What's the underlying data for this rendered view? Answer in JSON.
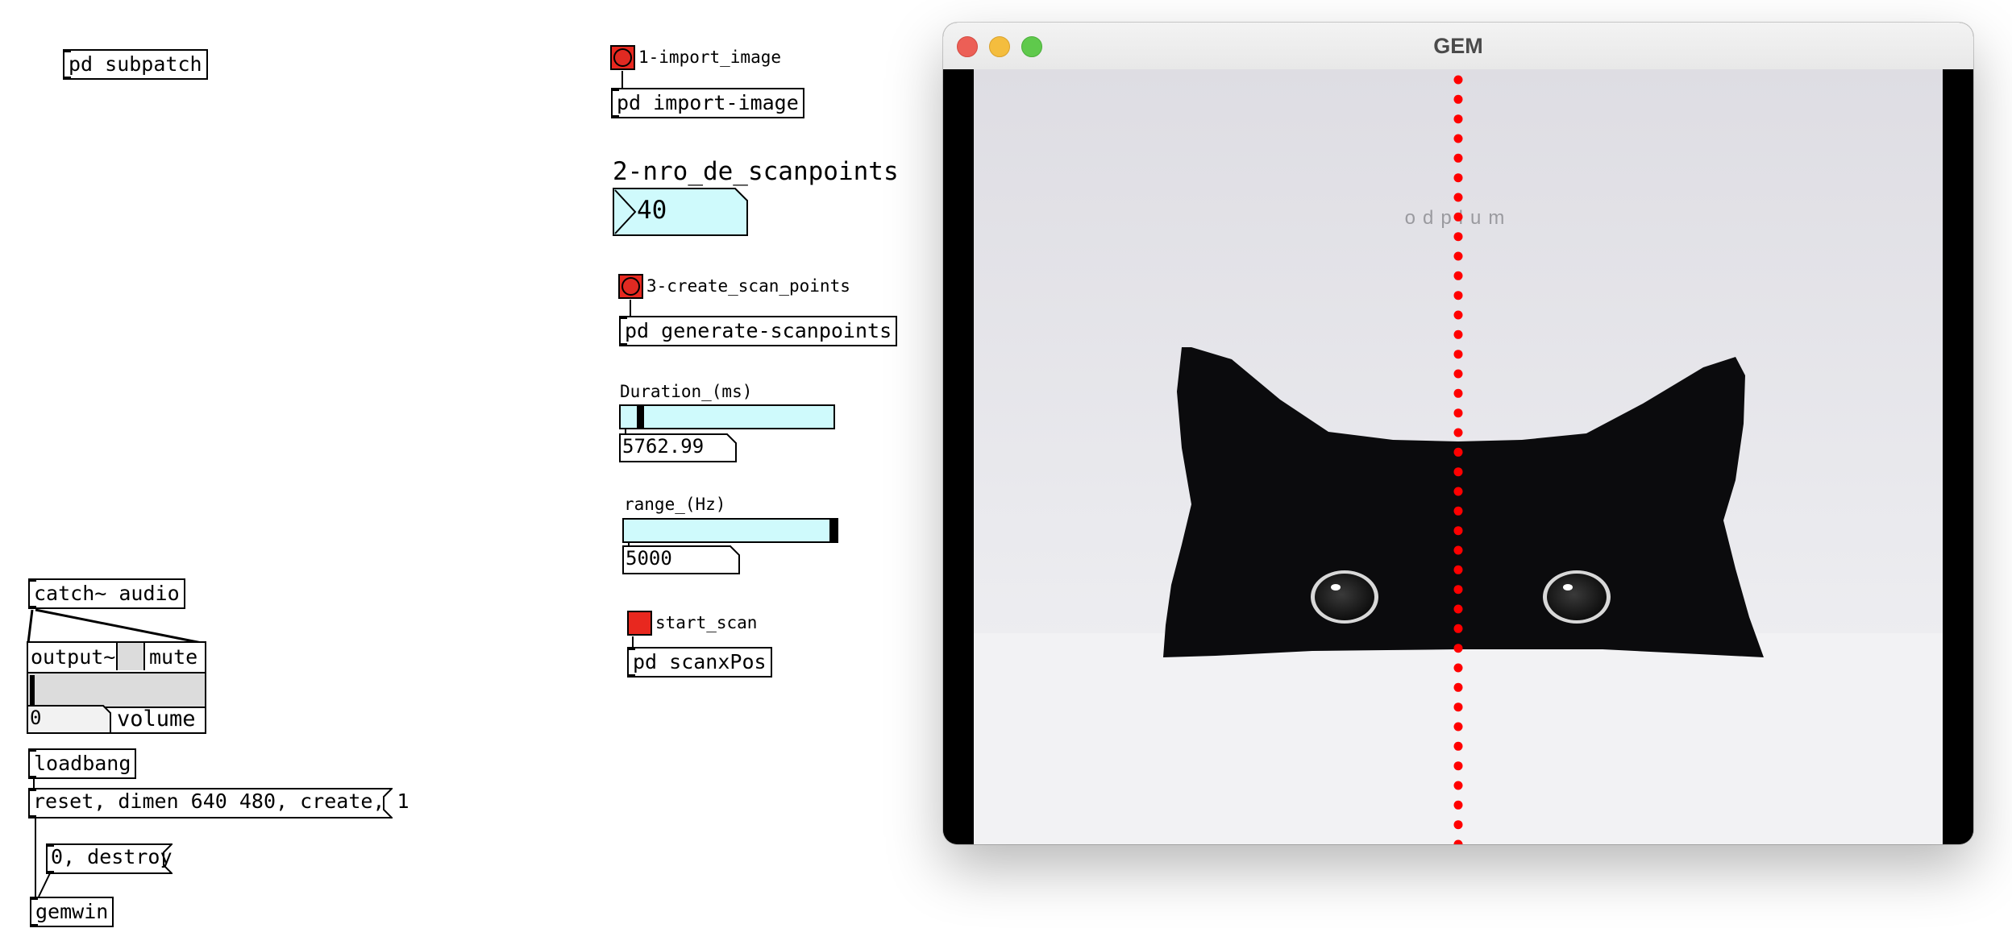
{
  "patch": {
    "subpatch_label": "pd subpatch",
    "catch_audio": "catch~ audio",
    "output_label": "output~",
    "mute_label": "mute",
    "volume_value": "0",
    "volume_label": "volume",
    "loadbang": "loadbang",
    "reset_msg": "reset, dimen 640 480, create, 1",
    "destroy_msg": "0, destroy",
    "gemwin": "gemwin",
    "import_bang_label": "1-import_image",
    "import_obj": "pd import-image",
    "scanpoints_label": "2-nro_de_scanpoints",
    "scanpoints_value": "40",
    "create_bang_label": "3-create_scan_points",
    "generate_obj": "pd generate-scanpoints",
    "duration_label": "Duration_(ms)",
    "duration_value": "5762.99",
    "duration_slider_level": 0.08,
    "range_label": "range_(Hz)",
    "range_value": "5000",
    "range_slider_level": 1.0,
    "start_scan_label": "start_scan",
    "scanxpos_obj": "pd scanxPos"
  },
  "gem_window": {
    "title": "GEM",
    "image_text": "odplum",
    "scan_points": 40
  },
  "colors": {
    "bang_red": "#e8281f",
    "slider_fill": "#cffafc",
    "scan_dot": "#ff0000"
  }
}
